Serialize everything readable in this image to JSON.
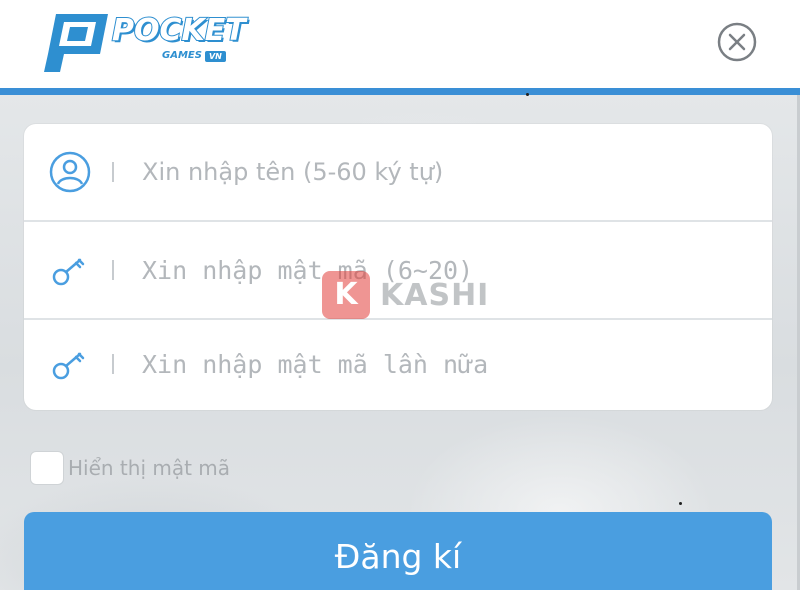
{
  "header": {
    "logo": {
      "word": "POCKET",
      "sub": "GAMES",
      "badge": "VN"
    },
    "close_icon": "close-circle-icon"
  },
  "form": {
    "username": {
      "icon": "user-circle-icon",
      "placeholder": "Xin nhập tên (5-60 ký tự)",
      "value": ""
    },
    "password": {
      "icon": "key-icon",
      "placeholder": "Xin nhập mật mã (6~20)",
      "value": ""
    },
    "confirm_password": {
      "icon": "key-icon",
      "placeholder": "Xin nhập mật mã lần nữa",
      "value": ""
    }
  },
  "show_password": {
    "label": "Hiển thị mật mã",
    "checked": false
  },
  "register_button": {
    "label": "Đăng kí"
  },
  "watermark": {
    "letter": "K",
    "text": "KASHI"
  },
  "colors": {
    "accent": "#3a8fd6",
    "button": "#4a9ee0",
    "icon": "#4a9ee0",
    "placeholder": "#b3b7bb"
  }
}
